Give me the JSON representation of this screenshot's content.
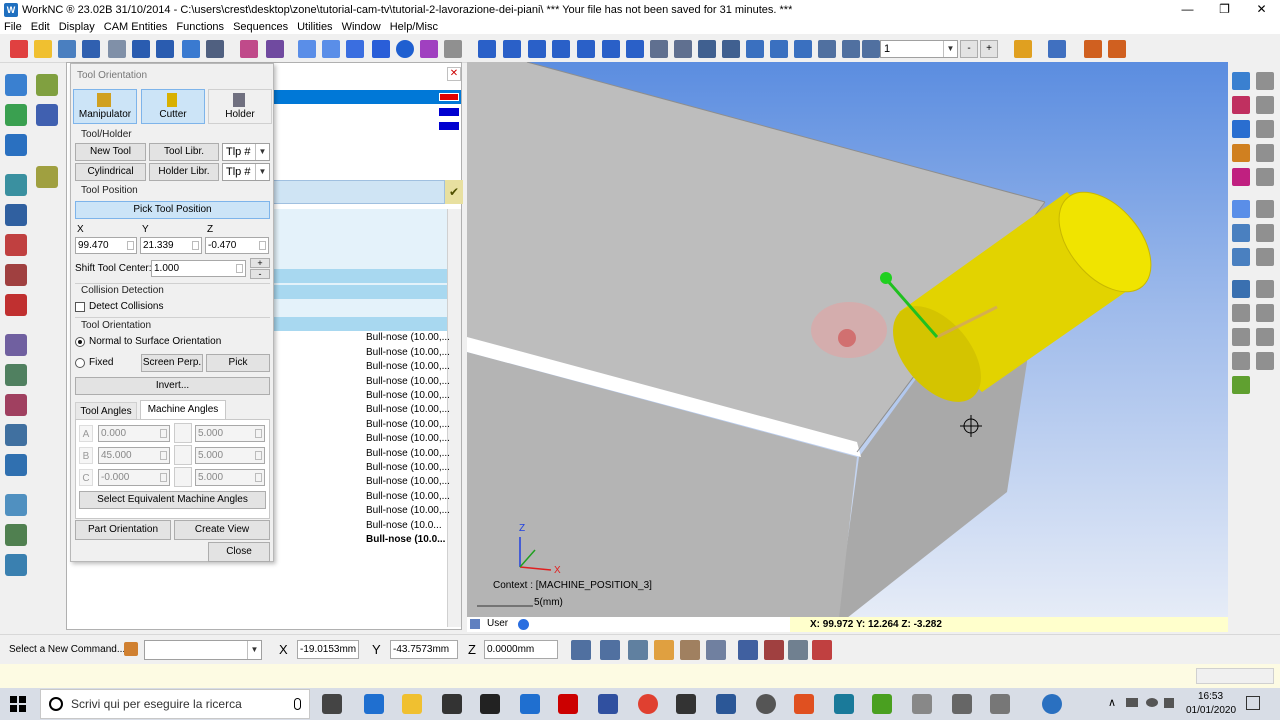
{
  "window": {
    "app_icon": "workNC-logo-icon",
    "title": "WorkNC ® 23.02B    31/10/2014 - C:\\users\\crest\\desktop\\zone\\tutorial-cam-tv\\tutorial-2-lavorazione-dei-piani\\ *** Your file has not been saved for 31 minutes. ***",
    "minimize": "—",
    "maximize": "❐",
    "close": "✕"
  },
  "menu": [
    "File",
    "Edit",
    "Display",
    "CAM Entities",
    "Functions",
    "Sequences",
    "Utilities",
    "Window",
    "Help/Misc"
  ],
  "toolbar": {
    "count_value": "1",
    "minus": "-",
    "plus": "+"
  },
  "dialog": {
    "title": "Tool Orientation",
    "tabs_top": {
      "manipulator": "Manipulator",
      "cutter": "Cutter",
      "holder": "Holder"
    },
    "tool_holder": {
      "section": "Tool/Holder",
      "new_tool": "New Tool",
      "tool_libr": "Tool Libr.",
      "tlp1": "Tlp #",
      "cylindrical": "Cylindrical",
      "holder_libr": "Holder Libr.",
      "tlp2": "Tlp #"
    },
    "tool_position": {
      "section": "Tool Position",
      "pick": "Pick Tool Position",
      "x_label": "X",
      "y_label": "Y",
      "z_label": "Z",
      "x": "99.470",
      "y": "21.339",
      "z": "-0.470",
      "shift_label": "Shift Tool Center:",
      "shift": "1.000",
      "shift_plus": "+",
      "shift_minus": "-"
    },
    "collision": {
      "section": "Collision Detection",
      "detect": "Detect Collisions"
    },
    "orientation": {
      "section": "Tool Orientation",
      "normal": "Normal to Surface Orientation",
      "fixed": "Fixed",
      "screen_perp": "Screen Perp.",
      "pick": "Pick",
      "invert": "Invert..."
    },
    "angles": {
      "tab_tool": "Tool Angles",
      "tab_machine": "Machine Angles",
      "a_label": "A",
      "b_label": "B",
      "c_label": "C",
      "a": "0.000",
      "b": "45.000",
      "c": "-0.000",
      "a_step": "5.000",
      "b_step": "5.000",
      "c_step": "5.000",
      "select_equiv": "Select Equivalent Machine Angles"
    },
    "part_orientation": "Part Orientation",
    "create_view": "Create View",
    "close": "Close"
  },
  "list": {
    "items": [
      "Bull-nose (10.00,...",
      "Bull-nose (10.00,...",
      "Bull-nose (10.00,...",
      "Bull-nose (10.00,...",
      "Bull-nose (10.00,...",
      "Bull-nose (10.00,...",
      "Bull-nose (10.00,...",
      "Bull-nose (10.00,...",
      "Bull-nose (10.00,...",
      "Bull-nose (10.00,...",
      "Bull-nose (10.00,...",
      "Bull-nose (10.00,...",
      "Bull-nose (10.00,...",
      "Bull-nose (10.0..."
    ]
  },
  "viewport": {
    "context": "Context : [MACHINE_POSITION_3]",
    "scale": "5(mm)",
    "axis_z": "Z",
    "axis_x": "X",
    "view_label": "User",
    "coords": "X:  99.972   Y:  12.264   Z:  -3.282"
  },
  "cmdbar": {
    "prompt": "Select a New Command...",
    "x_label": "X",
    "x_value": "-19.0153mm",
    "y_label": "Y",
    "y_value": "-43.7573mm",
    "z_label": "Z",
    "z_value": "0.0000mm"
  },
  "taskbar": {
    "search": "Scrivi qui per eseguire la ricerca",
    "time": "16:53",
    "date": "01/01/2020"
  },
  "colors": {
    "tool_yellow": "#e6d600",
    "part_gray": "#bcbcbc",
    "selection_blue": "#0078d7",
    "highlight": "#a8d8f0"
  }
}
